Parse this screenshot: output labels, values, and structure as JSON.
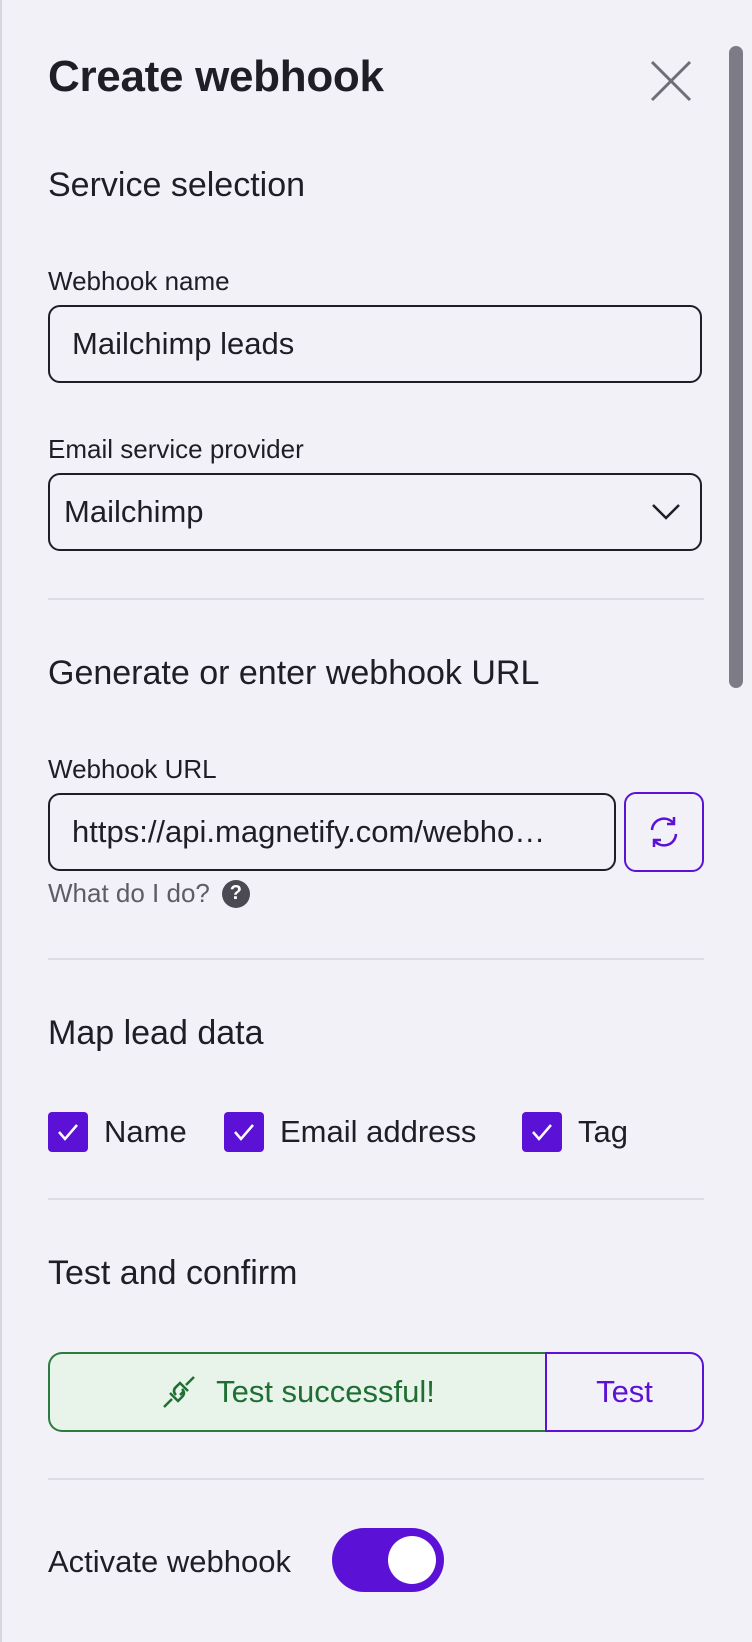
{
  "header": {
    "title": "Create webhook"
  },
  "service": {
    "heading": "Service selection",
    "webhook_name_label": "Webhook name",
    "webhook_name_value": "Mailchimp leads",
    "provider_label": "Email service provider",
    "provider_value": "Mailchimp"
  },
  "url_section": {
    "heading": "Generate or enter webhook URL",
    "label": "Webhook URL",
    "value": "https://api.magnetify.com/webho…",
    "help_text": "What do I do?",
    "help_icon": "?"
  },
  "map": {
    "heading": "Map lead data",
    "fields": [
      {
        "label": "Name",
        "checked": true
      },
      {
        "label": "Email address",
        "checked": true
      },
      {
        "label": "Tag",
        "checked": true
      }
    ]
  },
  "test": {
    "heading": "Test and confirm",
    "status_text": "Test successful!",
    "button_label": "Test"
  },
  "activate": {
    "label": "Activate webhook",
    "enabled": true
  },
  "colors": {
    "accent": "#5b12d6",
    "success": "#1f6f35",
    "success_bg": "#e8f3ea"
  }
}
